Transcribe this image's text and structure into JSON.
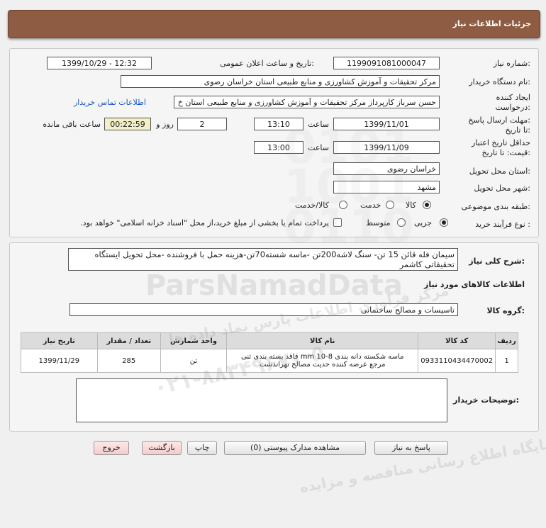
{
  "header": {
    "title": "جزئیات اطلاعات نیاز"
  },
  "form": {
    "need_number": {
      "label": "شماره نیاز:",
      "value": "1199091081000047"
    },
    "announce": {
      "label": "تاریخ و ساعت اعلان عمومی:",
      "value": "1399/10/29 - 12:32"
    },
    "buyer_org": {
      "label": "نام دستگاه خریدار:",
      "value": "مرکز تحقیقات و آموزش کشاورزی و منابع طبیعی استان خراسان رضوی"
    },
    "requester": {
      "label_line1": "ایجاد کننده",
      "label_line2": "درخواست:",
      "value": "حسن  سرباز کارپرداز مرکز تحقیقات و آموزش کشاورزی و منابع طبیعی استان خ",
      "contact_link": "اطلاعات تماس خریدار"
    },
    "deadline": {
      "label_line1": "مهلت ارسال پاسخ:",
      "label_line2": "تا تاریخ:",
      "date": "1399/11/01",
      "time_label": "ساعت",
      "time": "13:10",
      "days": "2",
      "days_label": "روز و",
      "remaining": "00:22:59",
      "remaining_label": "ساعت باقی مانده"
    },
    "validity": {
      "label_line1": "حداقل تاریخ اعتبار",
      "label_line2": "قیمت: تا تاریخ:",
      "date": "1399/11/09",
      "time_label": "ساعت",
      "time": "13:00"
    },
    "province": {
      "label": "استان محل تحویل:",
      "value": "خراسان رضوی"
    },
    "city": {
      "label": "شهر محل تحویل:",
      "value": "مشهد"
    },
    "category": {
      "label": "طبقه بندی موضوعی:",
      "options": [
        "کالا",
        "خدمت",
        "کالا/خدمت"
      ],
      "selected": "کالا"
    },
    "process": {
      "label": "نوع فرآیند خرید :",
      "options": [
        "جزیی",
        "متوسط"
      ],
      "selected": "جزیی",
      "note": "پرداخت تمام یا بخشی از مبلغ خرید،از محل \"اسناد خزانه اسلامی\" خواهد بود."
    }
  },
  "summary": {
    "label": "شرح کلی نیاز:",
    "text_line1": "سیمان فله قائن 15 تن- سنگ لاشه200تن -ماسه شسته70تن-هزینه حمل با فروشنده -محل تحویل ایستگاه",
    "text_line2": "تحقیقاتی کاشمر"
  },
  "goods": {
    "section_title": "اطلاعات کالاهای مورد نیاز",
    "group_label": "گروه کالا:",
    "group_value": "تاسیسات و مصالح ساختمانی",
    "columns": [
      "ردیف",
      "کد کالا",
      "نام کالا",
      "واحد شمارش",
      "تعداد / مقدار",
      "تاریخ نیاز"
    ],
    "rows": [
      {
        "index": "1",
        "code": "0933110434470002",
        "name_line1": "ماسه شکسته دانه بندی mm 10-8 فاقد بسته بندی تنی",
        "name_line2": "مرجع عرضه کننده حدیث مصالح تهراندشت",
        "unit": "تن",
        "qty": "285",
        "date": "1399/11/29"
      }
    ]
  },
  "buyer_notes": {
    "label": "توضیحات خریدار:",
    "value": ""
  },
  "buttons": {
    "reply": "پاسخ به نیاز",
    "docs": "مشاهده مدارک پیوستی (0)",
    "print": "چاپ",
    "back": "بازگشت",
    "exit": "خروج"
  },
  "watermark": {
    "brand": "ParsNamadData",
    "line_fa": "مرکز فراوری اطلاعات پارس نماد داده ها",
    "line_fa2": "پایگاه اطلاع رسانی مناقصه و مزایده",
    "phone": "۰۲۱-۸۸۳۴۹۶۷۰-۵"
  },
  "colors": {
    "header_bg": "#8e5b43",
    "link": "#1a55c8",
    "remaining_bg": "#f3f0c8"
  }
}
